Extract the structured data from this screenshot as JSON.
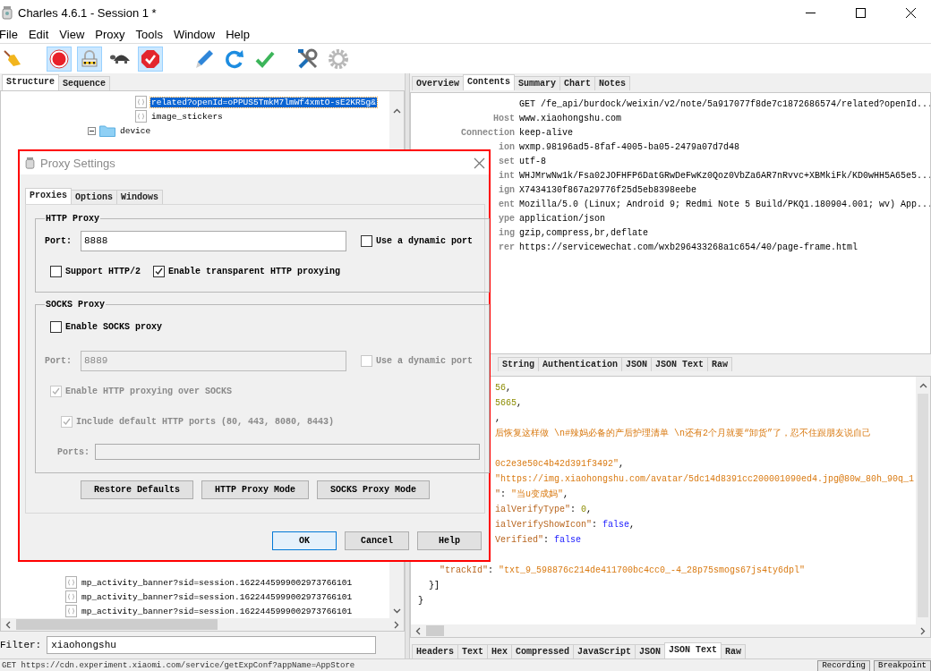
{
  "window": {
    "title": "Charles 4.6.1 - Session 1 *"
  },
  "menu": [
    "File",
    "Edit",
    "View",
    "Proxy",
    "Tools",
    "Window",
    "Help"
  ],
  "toolbar": [
    {
      "kind": "broom",
      "pressed": false
    },
    {
      "kind": "record",
      "pressed": true
    },
    {
      "kind": "lock",
      "pressed": true
    },
    {
      "kind": "turtle",
      "pressed": false
    },
    {
      "kind": "stop",
      "pressed": true
    },
    {
      "kind": "pen",
      "pressed": false
    },
    {
      "kind": "refresh",
      "pressed": false
    },
    {
      "kind": "check",
      "pressed": false
    },
    {
      "kind": "tools",
      "pressed": false
    },
    {
      "kind": "gear",
      "pressed": false
    }
  ],
  "left_tabs": [
    {
      "label": "Structure",
      "selected": true
    },
    {
      "label": "Sequence",
      "selected": false
    }
  ],
  "tree_top": [
    {
      "children": [
        {
          "children": [
            {
              "kind": "file",
              "label": "related?openId=oPPUS5TmkM7lmWf4xmtO-sE2KR5g&",
              "selected": true
            },
            {
              "kind": "file",
              "label": "image_stickers",
              "selected": false
            }
          ]
        }
      ]
    },
    {
      "kind": "folder",
      "label": "device",
      "expanded": true,
      "selected": false
    }
  ],
  "tree_bottom": [
    {
      "children": [
        {
          "children": [
            {
              "children": [
                {
                  "kind": "file",
                  "label": "mp_activity_banner?sid=session.1622445999002973766101",
                  "selected": false
                },
                {
                  "kind": "file",
                  "label": "mp_activity_banner?sid=session.1622445999002973766101",
                  "selected": false
                },
                {
                  "kind": "file",
                  "label": "mp_activity_banner?sid=session.1622445999002973766101",
                  "selected": false
                }
              ]
            }
          ]
        }
      ]
    }
  ],
  "filter": {
    "label": "Filter:",
    "value": "xiaohongshu"
  },
  "top_tabs": [
    {
      "label": "Overview",
      "selected": false
    },
    {
      "label": "Contents",
      "selected": true
    },
    {
      "label": "Summary",
      "selected": false
    },
    {
      "label": "Chart",
      "selected": false
    },
    {
      "label": "Notes",
      "selected": false
    }
  ],
  "headers": [
    {
      "value": "GET /fe_api/burdock/weixin/v2/note/5a917077f8de7c1872686574/related?openId..."
    },
    {
      "name": "Host",
      "value": "www.xiaohongshu.com"
    },
    {
      "name": "Connection",
      "value": "keep-alive"
    },
    {
      "name": "ion",
      "value": "wxmp.98196ad5-8faf-4005-ba05-2479a07d7d48"
    },
    {
      "name": "set",
      "value": "utf-8"
    },
    {
      "name": "int",
      "value": "WHJMrwNw1k/Fsa02JOFHFP6DatGRwDeFwKz0Qoz0VbZa6AR7nRvvc+XBMkiFk/KD0wHH5A65e5..."
    },
    {
      "name": "ign",
      "value": "X7434130f867a29776f25d5eb8398eebe"
    },
    {
      "name": "ent",
      "value": "Mozilla/5.0 (Linux; Android 9; Redmi Note 5 Build/PKQ1.180904.001; wv) App..."
    },
    {
      "name": "ype",
      "value": "application/json"
    },
    {
      "name": "ing",
      "value": "gzip,compress,br,deflate"
    },
    {
      "name": "rer",
      "value": "https://servicewechat.com/wxb296433268a1c654/40/page-frame.html"
    }
  ],
  "middle_tabs": [
    {
      "label": "String",
      "selected": false
    },
    {
      "label": "Authentication",
      "selected": false
    },
    {
      "label": "JSON",
      "selected": false
    },
    {
      "label": "JSON Text",
      "selected": false
    },
    {
      "label": "Raw",
      "selected": false
    }
  ],
  "json_lines": [
    {
      "kind": "clipped",
      "parts": [
        {
          "text": "56",
          "kind": "num"
        },
        {
          "text": ",",
          "kind": "punct"
        }
      ]
    },
    {
      "kind": "clipped",
      "parts": [
        {
          "text": "5665",
          "kind": "num"
        },
        {
          "text": ",",
          "kind": "punct"
        }
      ]
    },
    {
      "kind": "clipped",
      "parts": [
        {
          "text": ",",
          "kind": "punct"
        }
      ]
    },
    {
      "kind": "clipped",
      "parts": [
        {
          "text": "后恢复这样做 \\n#辣妈必备的产后护理清单 \\n还有2个月就要“卸货”了，忍不住跟朋友说自己",
          "kind": "str"
        }
      ]
    },
    {
      "kind": "blank"
    },
    {
      "kind": "clipped",
      "parts": [
        {
          "text": "0c2e3e50c4b42d391f3492\"",
          "kind": "str"
        },
        {
          "text": ",",
          "kind": "punct"
        }
      ]
    },
    {
      "kind": "clipped",
      "parts": [
        {
          "text": "\"https://img.xiaohongshu.com/avatar/5dc14d8391cc200001090ed4.jpg@80w_80h_90q_1",
          "kind": "str"
        }
      ]
    },
    {
      "kind": "clipped",
      "parts": [
        {
          "text": "\"",
          "kind": "key"
        },
        {
          "text": ": ",
          "kind": "punct"
        },
        {
          "text": "\"当u变成妈\"",
          "kind": "str"
        },
        {
          "text": ",",
          "kind": "punct"
        }
      ]
    },
    {
      "kind": "clipped",
      "parts": [
        {
          "text": "ialVerifyType\"",
          "kind": "key"
        },
        {
          "text": ": ",
          "kind": "punct"
        },
        {
          "text": "0",
          "kind": "num"
        },
        {
          "text": ",",
          "kind": "punct"
        }
      ]
    },
    {
      "kind": "clipped",
      "parts": [
        {
          "text": "ialVerifyShowIcon\"",
          "kind": "key"
        },
        {
          "text": ": ",
          "kind": "punct"
        },
        {
          "text": "false",
          "kind": "bool"
        },
        {
          "text": ",",
          "kind": "punct"
        }
      ]
    },
    {
      "kind": "clipped",
      "parts": [
        {
          "text": "Verified\"",
          "kind": "key"
        },
        {
          "text": ": ",
          "kind": "punct"
        },
        {
          "text": "false",
          "kind": "bool"
        }
      ]
    },
    {
      "kind": "blank"
    },
    {
      "kind": "code",
      "parts": [
        {
          "text": "    \"trackId\"",
          "kind": "key"
        },
        {
          "text": ": ",
          "kind": "punct"
        },
        {
          "text": "\"txt_9_598876c214de411700bc4cc0_-4_28p75smogs67js4ty6dpl\"",
          "kind": "str"
        }
      ]
    },
    {
      "kind": "code",
      "parts": [
        {
          "text": "  }]",
          "kind": "punct"
        }
      ]
    },
    {
      "kind": "code",
      "parts": [
        {
          "text": "}",
          "kind": "punct"
        }
      ]
    }
  ],
  "bottom_tabs": [
    {
      "label": "Headers",
      "selected": false
    },
    {
      "label": "Text",
      "selected": false
    },
    {
      "label": "Hex",
      "selected": false
    },
    {
      "label": "Compressed",
      "selected": false
    },
    {
      "label": "JavaScript",
      "selected": false
    },
    {
      "label": "JSON",
      "selected": false
    },
    {
      "label": "JSON Text",
      "selected": true
    },
    {
      "label": "Raw",
      "selected": false
    }
  ],
  "status_bar": {
    "text": "GET https://cdn.experiment.xiaomi.com/service/getExpConf?appName=AppStore",
    "buttons": [
      "Recording",
      "Breakpoint"
    ]
  },
  "dialog": {
    "title": "Proxy Settings",
    "tabs": [
      {
        "label": "Proxies",
        "selected": true
      },
      {
        "label": "Options",
        "selected": false
      },
      {
        "label": "Windows",
        "selected": false
      }
    ],
    "http_proxy": {
      "title": "HTTP Proxy",
      "port_label": "Port:",
      "port": "8888",
      "dynamic": {
        "label": "Use a dynamic port",
        "checked": false
      },
      "options": [
        {
          "label": "Support HTTP/2",
          "checked": false
        },
        {
          "label": "Enable transparent HTTP proxying",
          "checked": true
        }
      ]
    },
    "socks_proxy": {
      "title": "SOCKS Proxy",
      "enable": {
        "label": "Enable SOCKS proxy",
        "checked": false
      },
      "disabled": true,
      "port_label": "Port:",
      "port": "8889",
      "dynamic": {
        "label": "Use a dynamic port",
        "checked": false
      },
      "over_socks": {
        "label": "Enable HTTP proxying over SOCKS",
        "checked": true
      },
      "include_default": {
        "label": "Include default HTTP ports (80, 443, 8080, 8443)",
        "checked": true
      },
      "ports_label": "Ports:"
    },
    "mode_buttons": [
      "Restore Defaults",
      "HTTP Proxy Mode",
      "SOCKS Proxy Mode"
    ],
    "buttons": [
      {
        "label": "OK",
        "default": true
      },
      {
        "label": "Cancel",
        "default": false
      },
      {
        "label": "Help",
        "default": false
      }
    ]
  }
}
